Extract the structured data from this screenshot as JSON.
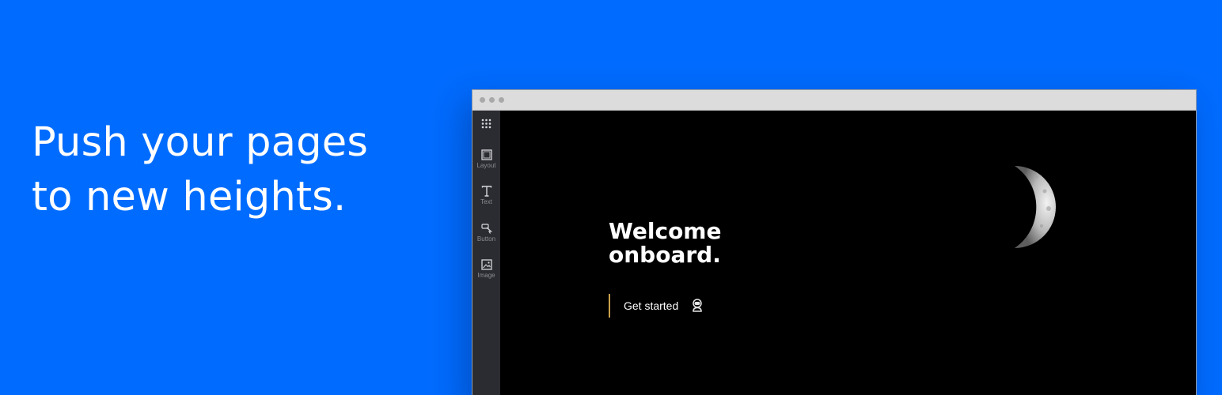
{
  "hero": {
    "line1": "Push your pages",
    "line2": "to new heights."
  },
  "browser_window": {
    "sidebar": {
      "items": [
        {
          "icon": "grid-icon",
          "label": ""
        },
        {
          "icon": "layout-icon",
          "label": "Layout"
        },
        {
          "icon": "text-icon",
          "label": "Text"
        },
        {
          "icon": "button-icon",
          "label": "Button"
        },
        {
          "icon": "image-icon",
          "label": "Image"
        }
      ]
    },
    "canvas": {
      "heading_line1": "Welcome",
      "heading_line2": "onboard.",
      "cta_label": "Get started",
      "cta_icon": "astronaut-icon"
    }
  },
  "colors": {
    "background": "#006cff",
    "sidebar": "#2b2c31",
    "titlebar": "#dcdcdc",
    "canvas": "#000000",
    "cta_accent": "#c8a04a"
  }
}
